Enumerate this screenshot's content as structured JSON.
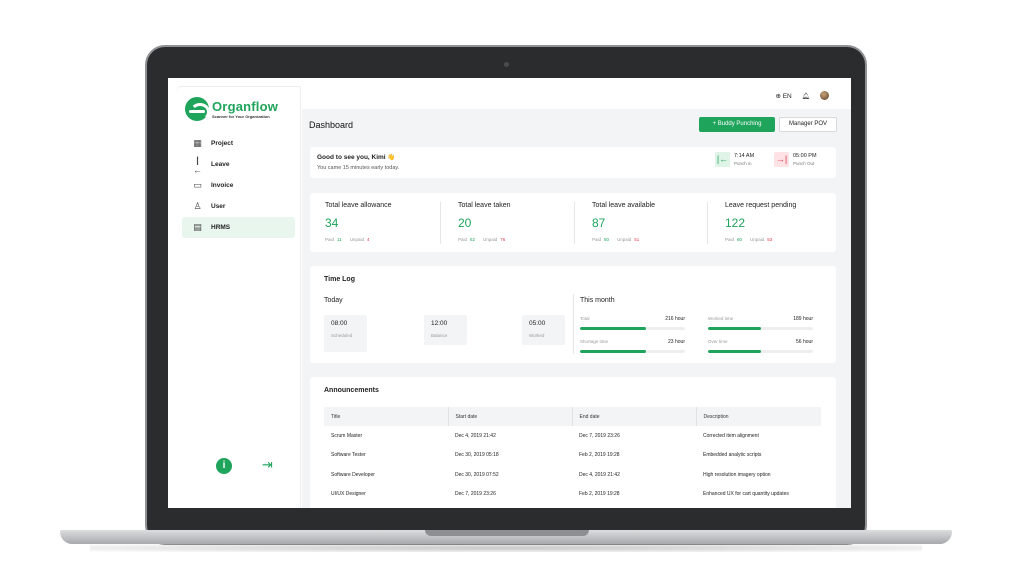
{
  "brand": {
    "name": "Organflow",
    "tagline": "Scanner for Your Organization",
    "accent": "#1fa45b",
    "danger": "#e2394b"
  },
  "sidebar": {
    "items": [
      {
        "label": "Project",
        "icon": "building-icon",
        "glyph": "▦",
        "active": false
      },
      {
        "label": "Leave",
        "icon": "leave-arrow-icon",
        "glyph": "|←",
        "active": false
      },
      {
        "label": "Invoice",
        "icon": "folder-icon",
        "glyph": "▭",
        "active": false
      },
      {
        "label": "User",
        "icon": "user-icon",
        "glyph": "♙",
        "active": false
      },
      {
        "label": "HRMS",
        "icon": "id-card-icon",
        "glyph": "▤",
        "active": true
      }
    ],
    "info_icon": "info-icon",
    "logout_icon": "logout-icon"
  },
  "topbar": {
    "language": "EN",
    "language_icon": "globe-icon",
    "notification_icon": "bell-icon"
  },
  "header": {
    "title": "Dashboard",
    "buddy_button": "+ Buddy Punching",
    "manager_button": "Manager POV"
  },
  "greeting": {
    "title": "Good to see you, Kimi 👋",
    "subtitle": "You came 15 minutes early today.",
    "punch_in": {
      "time": "7:14 AM",
      "label": "Punch in"
    },
    "punch_out": {
      "time": "05:00 PM",
      "label": "Punch Out"
    }
  },
  "stats": [
    {
      "label": "Total leave allowance",
      "value": "34",
      "paid_label": "Paid",
      "paid": "11",
      "unpaid_label": "Unpaid",
      "unpaid": "4"
    },
    {
      "label": "Total leave taken",
      "value": "20",
      "paid_label": "Paid",
      "paid": "62",
      "unpaid_label": "Unpaid",
      "unpaid": "76"
    },
    {
      "label": "Total leave available",
      "value": "87",
      "paid_label": "Paid",
      "paid": "50",
      "unpaid_label": "Unpaid",
      "unpaid": "51"
    },
    {
      "label": "Leave request pending",
      "value": "122",
      "paid_label": "Paid",
      "paid": "60",
      "unpaid_label": "Unpaid",
      "unpaid": "53"
    }
  ],
  "timelog": {
    "title": "Time Log",
    "today_label": "Today",
    "today": [
      {
        "time": "08:00",
        "label": "Scheduled"
      },
      {
        "time": "12:00",
        "label": "Balance"
      },
      {
        "time": "05:00",
        "label": "Worked"
      }
    ],
    "month_label": "This month",
    "metrics": [
      {
        "name": "Total",
        "value": "216 hour",
        "progress": 0.63
      },
      {
        "name": "Worked time",
        "value": "189 hour",
        "progress": 0.5
      },
      {
        "name": "Shortage time",
        "value": "23 hour",
        "progress": 0.63
      },
      {
        "name": "Over time",
        "value": "56 hour",
        "progress": 0.5
      }
    ]
  },
  "announcements": {
    "title": "Announcements",
    "columns": [
      "Title",
      "Start date",
      "End date",
      "Description"
    ],
    "rows": [
      [
        "Scrum Master",
        "Dec 4, 2019 21:42",
        "Dec 7, 2019 23:26",
        "Corrected item alignment"
      ],
      [
        "Software Tester",
        "Dec 30, 2019 05:18",
        "Feb 2, 2019 19:28",
        "Embedded analytic scripts"
      ],
      [
        "Software Developer",
        "Dec 30, 2019 07:52",
        "Dec 4, 2019 21:42",
        "High resolution imagery option"
      ],
      [
        "UI/UX Designer",
        "Dec 7, 2019 23:26",
        "Feb 2, 2019 19:28",
        "Enhanced UX for cart quantity updates"
      ]
    ]
  }
}
